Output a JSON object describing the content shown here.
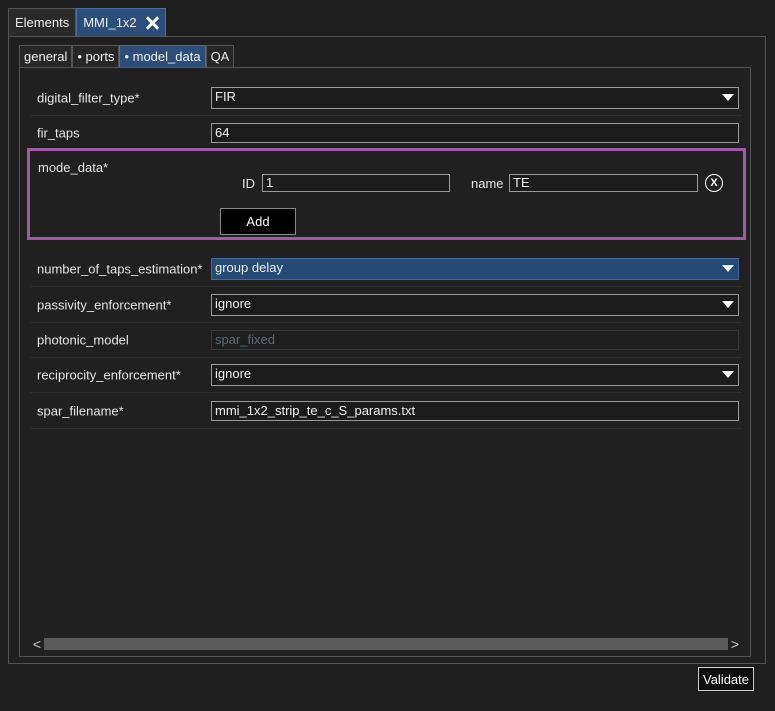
{
  "top_tabs": [
    {
      "label": "Elements"
    },
    {
      "label": "MMI_1x2"
    }
  ],
  "sub_tabs": [
    {
      "label": "general"
    },
    {
      "label": "• ports"
    },
    {
      "label": "• model_data"
    },
    {
      "label": "QA"
    }
  ],
  "fields": {
    "digital_filter_type": {
      "label": "digital_filter_type*",
      "value": "FIR"
    },
    "fir_taps": {
      "label": "fir_taps",
      "value": "64"
    },
    "mode_data": {
      "label": "mode_data*",
      "id_label": "ID",
      "id_value": "1",
      "name_label": "name",
      "name_value": "TE",
      "remove_glyph": "X",
      "add_label": "Add"
    },
    "number_of_taps_estimation": {
      "label": "number_of_taps_estimation*",
      "value": "group delay"
    },
    "passivity_enforcement": {
      "label": "passivity_enforcement*",
      "value": "ignore"
    },
    "photonic_model": {
      "label": "photonic_model",
      "value": "spar_fixed"
    },
    "reciprocity_enforcement": {
      "label": "reciprocity_enforcement*",
      "value": "ignore"
    },
    "spar_filename": {
      "label": "spar_filename*",
      "value": "mmi_1x2_strip_te_c_S_params.txt"
    }
  },
  "scrollbar": {
    "left_glyph": "<",
    "right_glyph": ">"
  },
  "validate_label": "Validate",
  "colors": {
    "highlight_border": "#a05aa8",
    "active_tab": "#2a4d7a",
    "selected_field": "#244a75"
  }
}
